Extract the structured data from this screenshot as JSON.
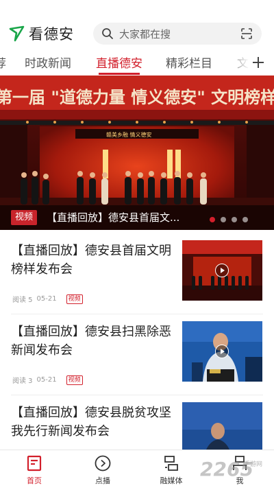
{
  "header": {
    "app_name": "看德安",
    "search_placeholder": "大家都在搜"
  },
  "tabs": [
    {
      "label": "荐"
    },
    {
      "label": "时政新闻"
    },
    {
      "label": "直播德安",
      "active": true
    },
    {
      "label": "精彩栏目"
    },
    {
      "label": "文"
    }
  ],
  "banner": {
    "tag": "视频",
    "title": "【直播回放】德安县首届文...",
    "backdrop_text": "第一届 \"道德力量 情义德安\" 文明榜样发布",
    "screen_text": "赣美乡融 情义德安",
    "slide_count": 4,
    "active_slide": 1
  },
  "news": [
    {
      "title": "【直播回放】德安县首届文明榜样发布会",
      "reads": "阅读 5",
      "date": "05-21",
      "badge": "视频"
    },
    {
      "title": "【直播回放】德安县扫黑除恶新闻发布会",
      "reads": "阅读 3",
      "date": "05-21",
      "badge": "视频"
    },
    {
      "title": "【直播回放】德安县脱贫攻坚我先行新闻发布会",
      "reads": "",
      "date": "",
      "badge": ""
    }
  ],
  "bottom_nav": [
    {
      "label": "首页",
      "icon": "home-icon",
      "active": true
    },
    {
      "label": "点播",
      "icon": "play-circle-icon"
    },
    {
      "label": "融媒体",
      "icon": "media-icon"
    },
    {
      "label": "我",
      "icon": "profile-icon"
    }
  ],
  "watermark": {
    "text": "2265",
    "sub": "手游网"
  },
  "colors": {
    "accent": "#d21f2b",
    "text": "#222222",
    "muted": "#999999"
  }
}
